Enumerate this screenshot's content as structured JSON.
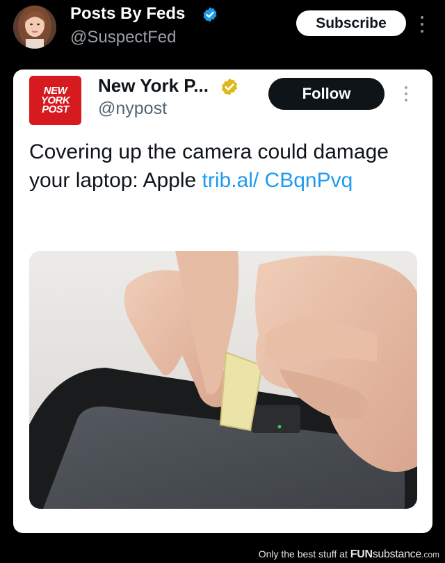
{
  "outer_post": {
    "author_name": "Posts By Feds",
    "handle": "@SuspectFed",
    "subscribe_label": "Subscribe",
    "verified": true,
    "icons": [
      "avatar",
      "verified-badge-blue",
      "more-options-icon"
    ]
  },
  "quoted_post": {
    "logo_lines": [
      "NEW",
      "YORK",
      "POST"
    ],
    "author_name": "New York P...",
    "handle": "@nypost",
    "follow_label": "Follow",
    "verified": "gold",
    "text": "Covering up the camera could damage your laptop: Apple ",
    "link_text": "trib.al/ CBqnPvq",
    "media_description": "photo"
  },
  "footer": {
    "prefix": "Only the best stuff at ",
    "brand_fun": "FUN",
    "brand_rest": "substance",
    "suffix": ".com"
  },
  "colors": {
    "background": "#000000",
    "card": "#ffffff",
    "link": "#1d9bf0",
    "verified_blue": "#1d9bf0",
    "verified_gold": "#e2b719",
    "nypost_red": "#d71920"
  }
}
